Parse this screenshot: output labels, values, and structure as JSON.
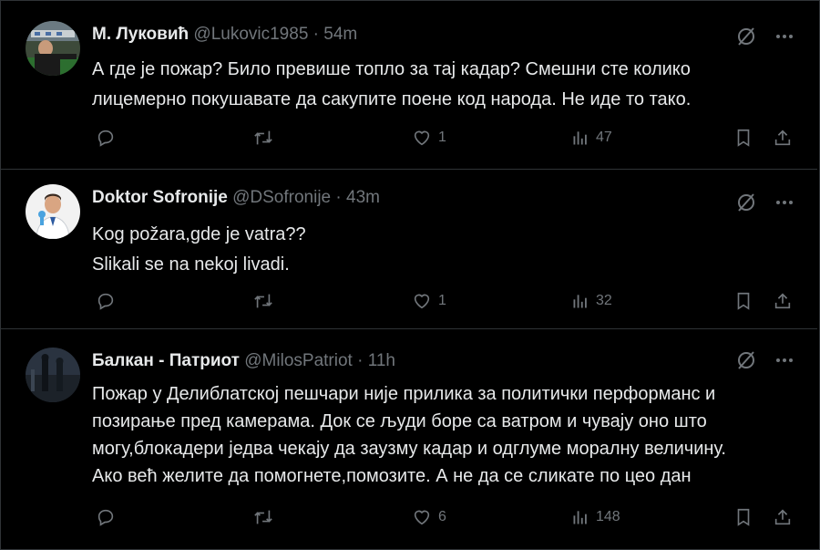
{
  "tweets": [
    {
      "name": "М. Луковић",
      "handle": "@Lukovic1985",
      "separator": "·",
      "time": "54m",
      "lines": [
        "А где је пожар? Било превише топло за тај кадар? Смешни сте колико",
        "лицемерно покушавате да сакупите поене код народа. Не иде то тако."
      ],
      "likes": "1",
      "views": "47"
    },
    {
      "name": "Doktor Sofronije",
      "handle": "@DSofronije",
      "separator": "·",
      "time": "43m",
      "lines": [
        "Kog požara,gde je vatra??",
        "Slikali se na nekoj livadi."
      ],
      "likes": "1",
      "views": "32"
    },
    {
      "name": "Балкан - Патриот",
      "handle": "@MilosPatriot",
      "separator": "·",
      "time": "11h",
      "lines": [
        "Пожар у Делиблатској пешчари није прилика за политички перформанс и",
        "позирање пред камерама. Док се људи боре са ватром и чувају оно што",
        "могу,блокадери једва чекају да заузму кадар и одглуме моралну величину.",
        "Ако већ желите да помогнете,помозите. А не да се сликате по цео дан"
      ],
      "likes": "6",
      "views": "148"
    }
  ],
  "icons": {
    "reply": "reply-icon",
    "retweet": "retweet-icon",
    "like": "heart-icon",
    "views": "views-icon",
    "bookmark": "bookmark-icon",
    "share": "share-icon",
    "grok": "grok-icon",
    "more": "more-icon"
  },
  "colors": {
    "background": "#000000",
    "text": "#e7e9ea",
    "secondary": "#71767b",
    "border": "#2f3336"
  }
}
